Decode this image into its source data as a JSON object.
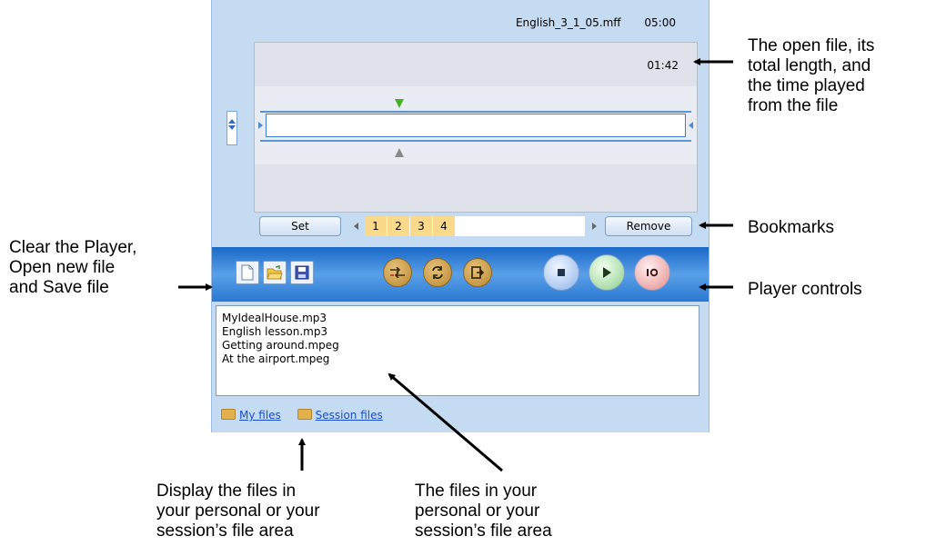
{
  "player": {
    "file_name": "English_3_1_05.mff",
    "total_length": "05:00",
    "time_played": "01:42",
    "set_label": "Set",
    "remove_label": "Remove",
    "bookmarks": [
      "1",
      "2",
      "3",
      "4"
    ],
    "toolbar": [
      "new-file-icon",
      "open-folder-icon",
      "save-disk-icon",
      "shuffle-icon",
      "repeat-icon",
      "exit-icon",
      "stop-icon",
      "play-icon",
      "record-icon"
    ],
    "files": [
      "MyIdealHouse.mp3",
      "English lesson.mp3",
      "Getting around.mpeg",
      "At the airport.mpeg"
    ],
    "tabs": [
      "My files",
      "Session files"
    ]
  },
  "annotations": {
    "open_file": [
      "The open file, its",
      "total length, and",
      "the time played",
      "from the file"
    ],
    "bookmarks": "Bookmarks",
    "player_controls": "Player controls",
    "clear_player": [
      "Clear the Player,",
      "Open new file",
      "and Save file"
    ],
    "display_files": [
      "Display the files in",
      "your personal or your",
      "session’s file area"
    ],
    "files_in_area": [
      "The files in your",
      "personal or your",
      "session’s file area"
    ]
  },
  "colors": {
    "panel": "#c4dbf2",
    "toolbar_blue": "#2a78d2",
    "bookmark": "#fbd98a",
    "link": "#1b4ec4"
  }
}
